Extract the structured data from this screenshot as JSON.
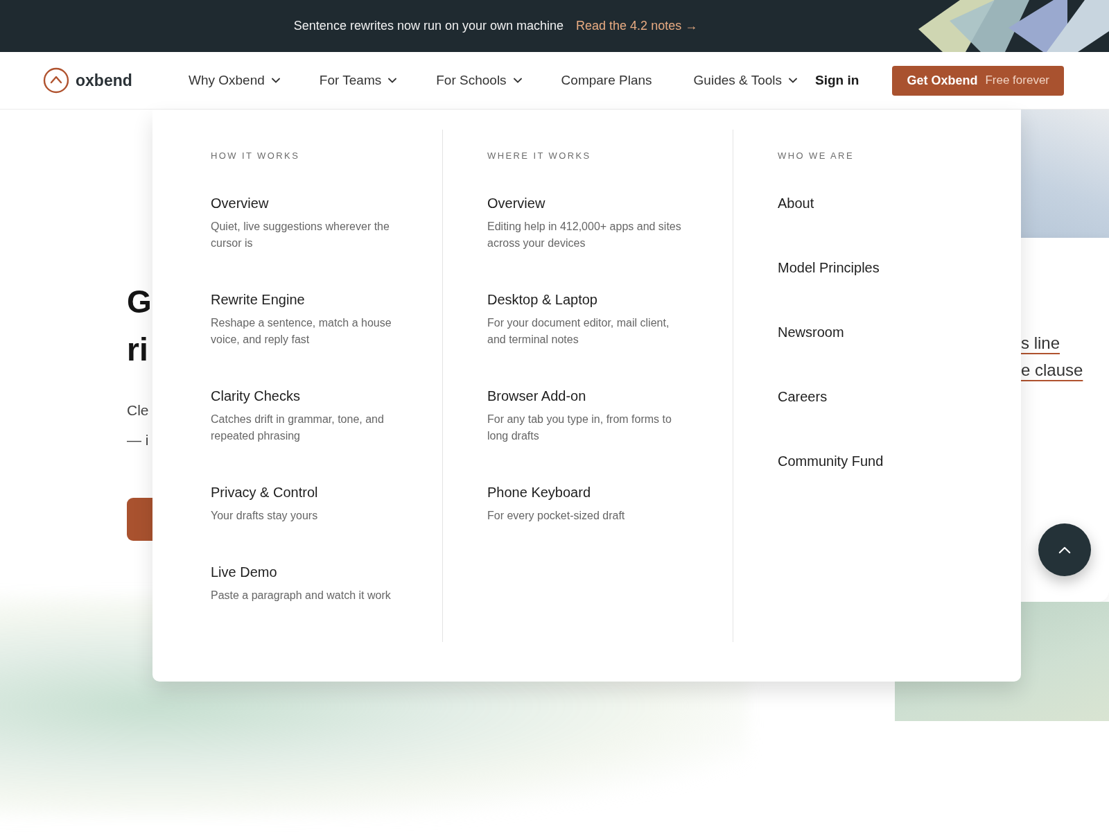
{
  "announcement": {
    "text": "Sentence rewrites now run on your own machine",
    "link": "Read the 4.2 notes",
    "arrow": "→"
  },
  "nav": {
    "brand": "oxbend",
    "items": [
      {
        "label": "Why Oxbend",
        "dropdown": true
      },
      {
        "label": "For Teams",
        "dropdown": true
      },
      {
        "label": "For Schools",
        "dropdown": true
      },
      {
        "label": "Compare Plans",
        "dropdown": false
      },
      {
        "label": "Guides & Tools",
        "dropdown": true
      }
    ],
    "sign_in": "Sign in",
    "cta": {
      "label": "Get Oxbend",
      "note": "Free forever"
    }
  },
  "hero": {
    "heading_lines": [
      "G",
      "ri"
    ],
    "subtitle_lines": [
      "Cle",
      "— i"
    ]
  },
  "side_card": {
    "links": [
      "s line",
      "e clause"
    ]
  },
  "mega_menu": {
    "columns": [
      {
        "heading": "HOW IT WORKS",
        "items": [
          {
            "title": "Overview",
            "description": "Quiet, live suggestions wherever the cursor is"
          },
          {
            "title": "Rewrite Engine",
            "description": "Reshape a sentence, match a house voice, and reply fast"
          },
          {
            "title": "Clarity Checks",
            "description": "Catches drift in grammar, tone, and repeated phrasing"
          },
          {
            "title": "Privacy & Control",
            "description": "Your drafts stay yours"
          },
          {
            "title": "Live Demo",
            "description": "Paste a paragraph and watch it work"
          }
        ]
      },
      {
        "heading": "WHERE IT WORKS",
        "items": [
          {
            "title": "Overview",
            "description": "Editing help in 412,000+ apps and sites across your devices"
          },
          {
            "title": "Desktop & Laptop",
            "description": "For your document editor, mail client, and terminal notes"
          },
          {
            "title": "Browser Add-on",
            "description": "For any tab you type in, from forms to long drafts"
          },
          {
            "title": "Phone Keyboard",
            "description": "For every pocket-sized draft"
          }
        ]
      },
      {
        "heading": "WHO WE ARE",
        "items": [
          {
            "title": "About"
          },
          {
            "title": "Model Principles"
          },
          {
            "title": "Newsroom"
          },
          {
            "title": "Careers"
          },
          {
            "title": "Community Fund"
          }
        ]
      }
    ]
  }
}
